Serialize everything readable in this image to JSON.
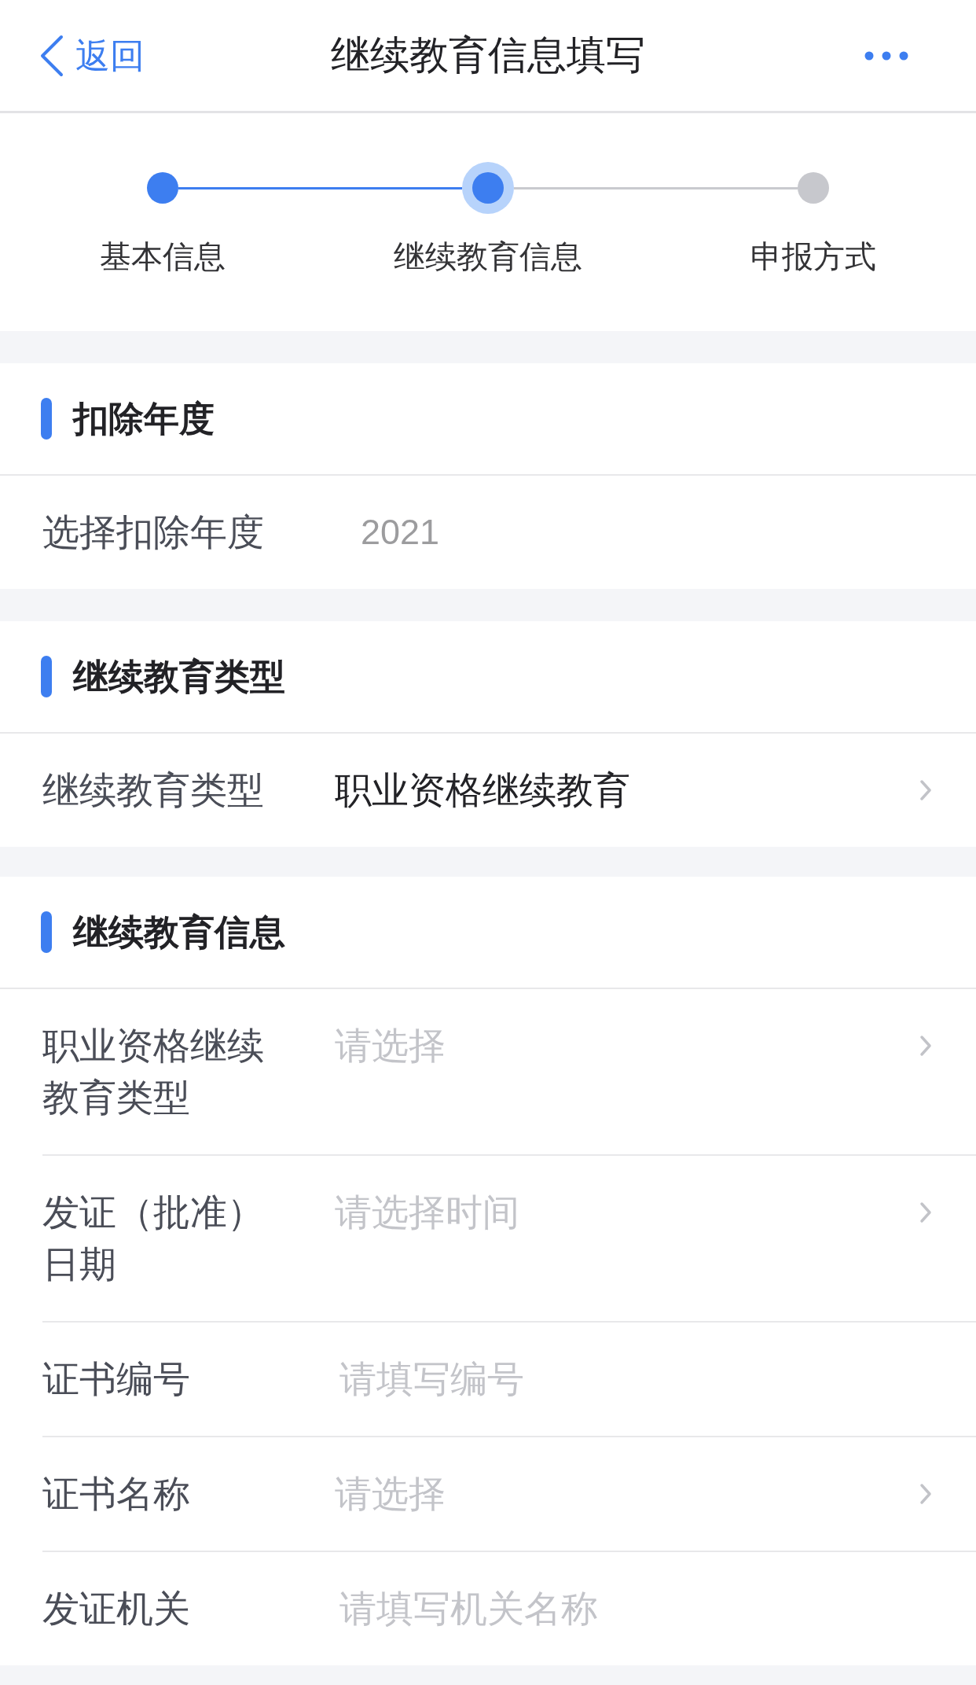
{
  "nav": {
    "back": "返回",
    "title": "继续教育信息填写"
  },
  "steps": [
    {
      "label": "基本信息",
      "done": true,
      "current": false
    },
    {
      "label": "继续教育信息",
      "done": false,
      "current": true
    },
    {
      "label": "申报方式",
      "done": false,
      "current": false
    }
  ],
  "sections": [
    {
      "title": "扣除年度",
      "rows": [
        {
          "kind": "display",
          "label": "选择扣除年度",
          "value": "2021"
        }
      ]
    },
    {
      "title": "继续教育类型",
      "rows": [
        {
          "kind": "picker",
          "label": "继续教育类型",
          "value": "职业资格继续教育"
        }
      ]
    },
    {
      "title": "继续教育信息",
      "rows": [
        {
          "kind": "picker",
          "label": "职业资格继续教育类型",
          "placeholder": "请选择"
        },
        {
          "kind": "picker",
          "label": "发证（批准）日期",
          "placeholder": "请选择时间"
        },
        {
          "kind": "input",
          "label": "证书编号",
          "placeholder": "请填写编号"
        },
        {
          "kind": "picker",
          "label": "证书名称",
          "placeholder": "请选择"
        },
        {
          "kind": "input",
          "label": "发证机关",
          "placeholder": "请填写机关名称"
        }
      ]
    }
  ]
}
